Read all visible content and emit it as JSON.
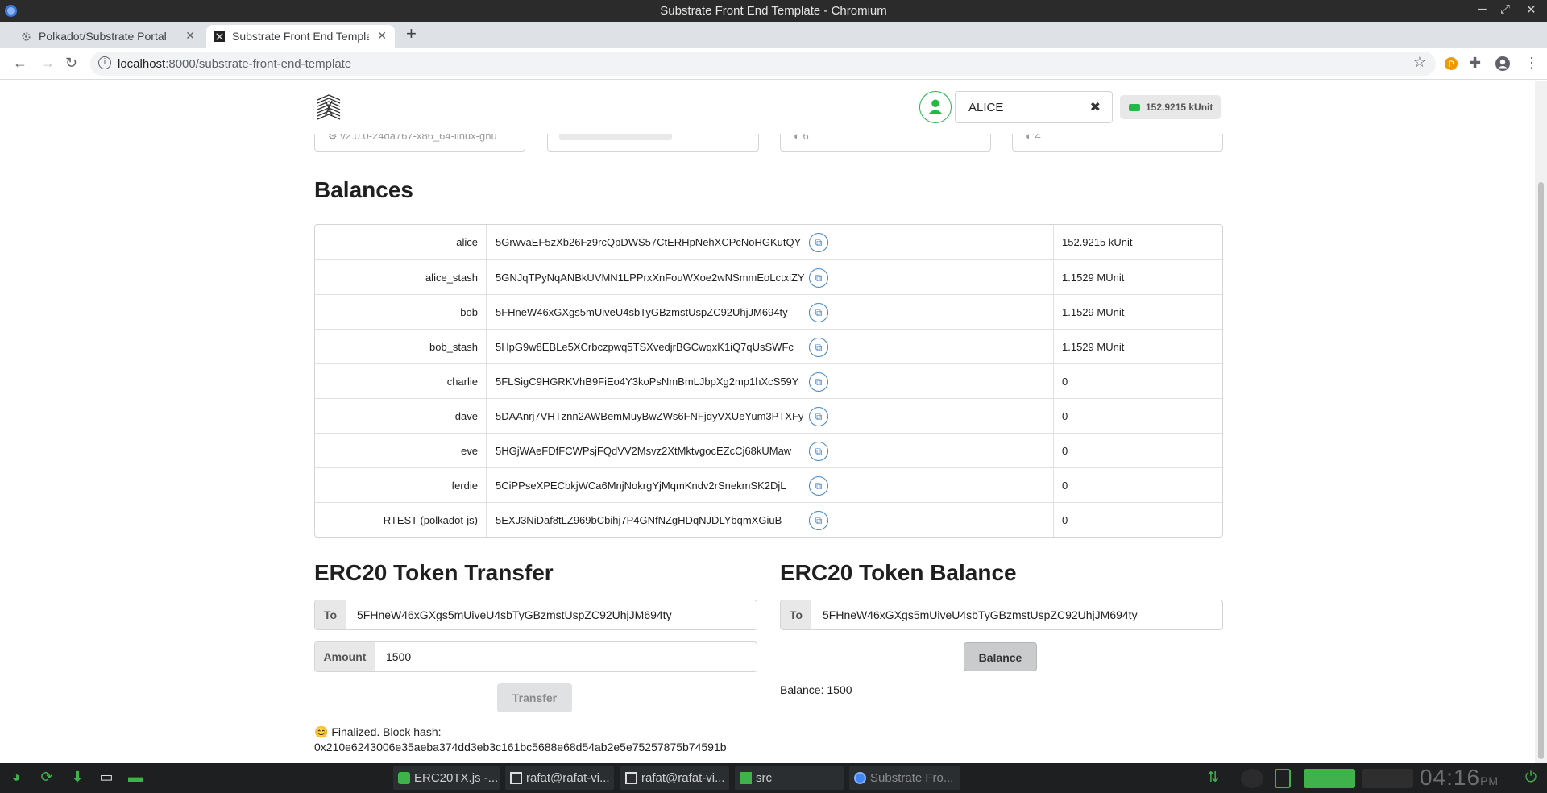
{
  "window": {
    "title": "Substrate Front End Template - Chromium"
  },
  "tabs": [
    {
      "label": "Polkadot/Substrate Portal",
      "close": "✕"
    },
    {
      "label": "Substrate Front End Templa",
      "close": "✕"
    }
  ],
  "new_tab": "+",
  "address_bar": {
    "host": "localhost",
    "path": ":8000/substrate-front-end-template"
  },
  "account": {
    "selected": "ALICE",
    "clear_icon": "✖",
    "balance": "152.9215 kUnit"
  },
  "info_cards": [
    {
      "meta": "⚙ v2.0.0-24da767-x86_64-linux-gnu"
    },
    {
      "meta": ""
    },
    {
      "meta": "◐ 6"
    },
    {
      "meta": "◐ 4"
    }
  ],
  "balances": {
    "title": "Balances",
    "rows": [
      {
        "name": "alice",
        "address": "5GrwvaEF5zXb26Fz9rcQpDWS57CtERHpNehXCPcNoHGKutQY",
        "balance": "152.9215 kUnit"
      },
      {
        "name": "alice_stash",
        "address": "5GNJqTPyNqANBkUVMN1LPPrxXnFouWXoe2wNSmmEoLctxiZY",
        "balance": "1.1529 MUnit"
      },
      {
        "name": "bob",
        "address": "5FHneW46xGXgs5mUiveU4sbTyGBzmstUspZC92UhjJM694ty",
        "balance": "1.1529 MUnit"
      },
      {
        "name": "bob_stash",
        "address": "5HpG9w8EBLe5XCrbczpwq5TSXvedjrBGCwqxK1iQ7qUsSWFc",
        "balance": "1.1529 MUnit"
      },
      {
        "name": "charlie",
        "address": "5FLSigC9HGRKVhB9FiEo4Y3koPsNmBmLJbpXg2mp1hXcS59Y",
        "balance": "0"
      },
      {
        "name": "dave",
        "address": "5DAAnrj7VHTznn2AWBemMuyBwZWs6FNFjdyVXUeYum3PTXFy",
        "balance": "0"
      },
      {
        "name": "eve",
        "address": "5HGjWAeFDfFCWPsjFQdVV2Msvz2XtMktvgocEZcCj68kUMaw",
        "balance": "0"
      },
      {
        "name": "ferdie",
        "address": "5CiPPseXPECbkjWCa6MnjNokrgYjMqmKndv2rSnekmSK2DjL",
        "balance": "0"
      },
      {
        "name": "RTEST (polkadot-js)",
        "address": "5EXJ3NiDaf8tLZ969bCbihj7P4GNfNZgHDqNJDLYbqmXGiuB",
        "balance": "0"
      }
    ]
  },
  "transfer": {
    "title": "ERC20 Token Transfer",
    "to_label": "To",
    "to_value": "5FHneW46xGXgs5mUiveU4sbTyGBzmstUspZC92UhjJM694ty",
    "amount_label": "Amount",
    "amount_value": "1500",
    "button": "Transfer",
    "status_line1": "😊 Finalized. Block hash:",
    "status_line2": "0x210e6243006e35aeba374dd3eb3c161bc5688e68d54ab2e5e75257875b74591b"
  },
  "balance_query": {
    "title": "ERC20 Token Balance",
    "to_label": "To",
    "to_value": "5FHneW46xGXgs5mUiveU4sbTyGBzmstUspZC92UhjJM694ty",
    "button": "Balance",
    "result": "Balance: 1500"
  },
  "taskbar": {
    "tasks": [
      {
        "label": "ERC20TX.js -..."
      },
      {
        "label": "rafat@rafat-vi..."
      },
      {
        "label": "rafat@rafat-vi..."
      },
      {
        "label": "src"
      },
      {
        "label": "Substrate Fro..."
      }
    ],
    "clock": "04:16",
    "clock_suffix": "PM"
  },
  "colors": {
    "accent_green": "#21ba45",
    "link_blue": "#4183c4",
    "taskbar_green": "#3fb24b"
  }
}
